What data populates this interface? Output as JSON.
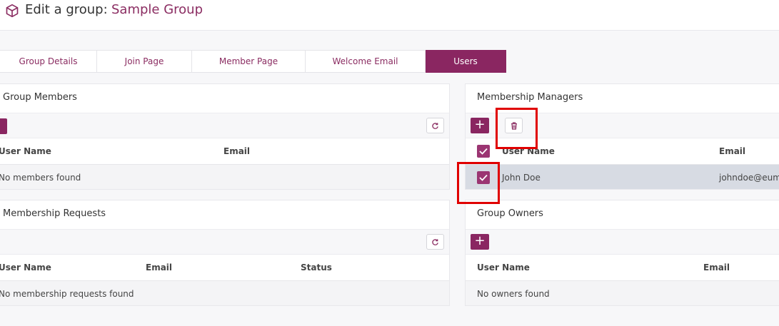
{
  "header": {
    "title_label": "Edit a group:",
    "group_name": "Sample Group",
    "icon": "cube-icon"
  },
  "tabs": [
    {
      "label": "Group Details",
      "active": false
    },
    {
      "label": "Join Page",
      "active": false
    },
    {
      "label": "Member Page",
      "active": false
    },
    {
      "label": "Welcome Email",
      "active": false
    },
    {
      "label": "Users",
      "active": true
    }
  ],
  "group_members": {
    "title": "Group Members",
    "columns": [
      "User Name",
      "Email"
    ],
    "empty_text": "No members found"
  },
  "membership_requests": {
    "title": "Membership Requests",
    "columns": [
      "User Name",
      "Email",
      "Status"
    ],
    "empty_text": "No membership requests found"
  },
  "membership_managers": {
    "title": "Membership Managers",
    "add_label": "+",
    "columns": [
      "User Name",
      "Email"
    ],
    "rows": [
      {
        "name": "John Doe",
        "email": "johndoe@eum.",
        "selected": true
      }
    ]
  },
  "group_owners": {
    "title": "Group Owners",
    "add_label": "+",
    "columns": [
      "User Name",
      "Email"
    ],
    "empty_text": "No owners found"
  },
  "colors": {
    "accent": "#8a2661",
    "accent_text": "#8b2d62",
    "selected_row": "#d7dbe3",
    "annotation": "#e00000"
  }
}
